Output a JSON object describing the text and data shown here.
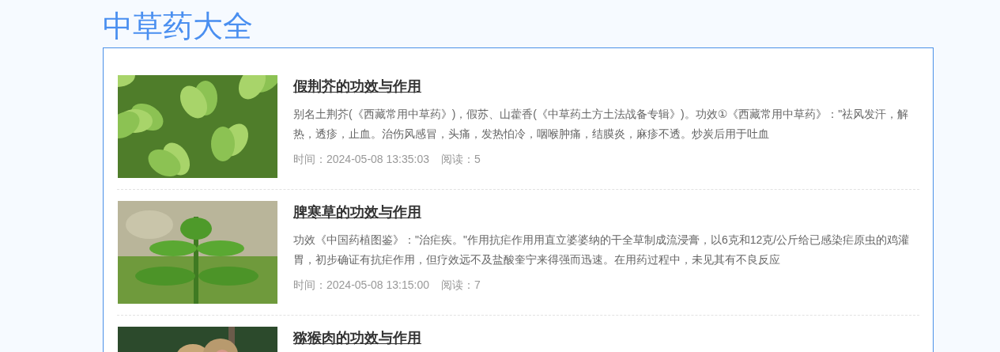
{
  "page_title": "中草药大全",
  "articles": [
    {
      "title": "假荆芥的功效与作用",
      "summary": "别名土荆芥(《西藏常用中草药》)，假苏、山藿香(《中草药土方土法战备专辑》)。功效①《西藏常用中草药》：\"祛风发汗，解热，透疹，止血。治伤风感冒，头痛，发热怕冷，咽喉肿痛，结膜炎，麻疹不透。炒炭后用于吐血",
      "time": "时间：2024-05-08 13:35:03",
      "reads": "阅读：5"
    },
    {
      "title": "脾寒草的功效与作用",
      "summary": "功效《中国药植图鉴》：\"治疟疾。\"作用抗疟作用用直立婆婆纳的干全草制成流浸膏，以6克和12克/公斤给已感染疟原虫的鸡灌胃，初步确证有抗疟作用，但疗效远不及盐酸奎宁来得强而迅速。在用药过程中，未见其有不良反应",
      "time": "时间：2024-05-08 13:15:00",
      "reads": "阅读：7"
    },
    {
      "title": "猕猴肉的功效与作用"
    }
  ]
}
